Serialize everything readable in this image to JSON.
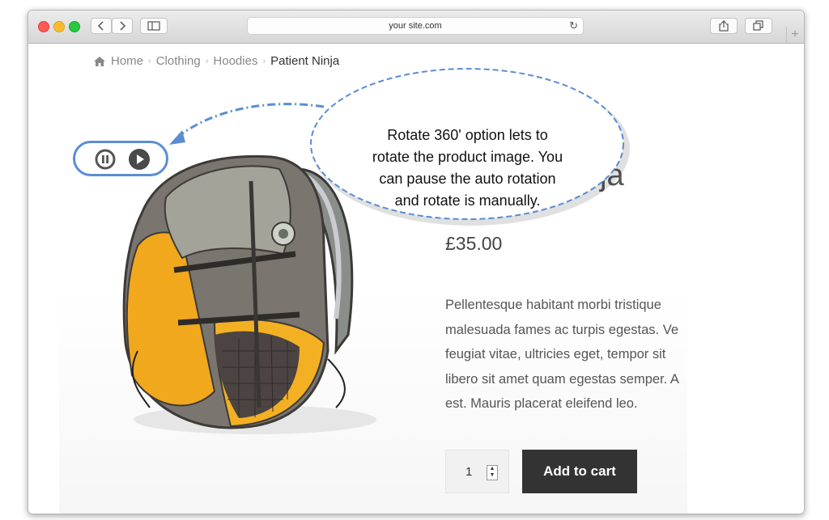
{
  "browser": {
    "url": "your site.com",
    "back_icon": "chevron-left-icon",
    "forward_icon": "chevron-right-icon",
    "sidebar_icon": "sidebar-icon",
    "reload_icon": "reload-icon",
    "share_icon": "share-icon",
    "tabs_icon": "tabs-icon",
    "new_tab_label": "+"
  },
  "breadcrumb": {
    "home_icon": "home-icon",
    "items": [
      "Home",
      "Clothing",
      "Hoodies"
    ],
    "separator": "›",
    "current": "Patient Ninja"
  },
  "product": {
    "title_visible_tail": "ja",
    "price": "£35.00",
    "description_lines": [
      "Pellentesque habitant morbi tristique",
      "malesuada fames ac turpis egestas. Ve",
      "feugiat vitae, ultricies eget, tempor sit",
      "libero sit amet quam egestas semper. A",
      "est. Mauris placerat eleifend leo."
    ],
    "quantity": "1",
    "add_to_cart_label": "Add to cart",
    "image": "backpack-image"
  },
  "rotate_controls": {
    "pause_icon": "pause-icon",
    "play_icon": "play-icon"
  },
  "callout": {
    "lines": [
      "Rotate 360' option lets to",
      "rotate the product image. You",
      "can pause the auto rotation",
      "and rotate is manually."
    ],
    "accent_color": "#5b8dd3"
  }
}
